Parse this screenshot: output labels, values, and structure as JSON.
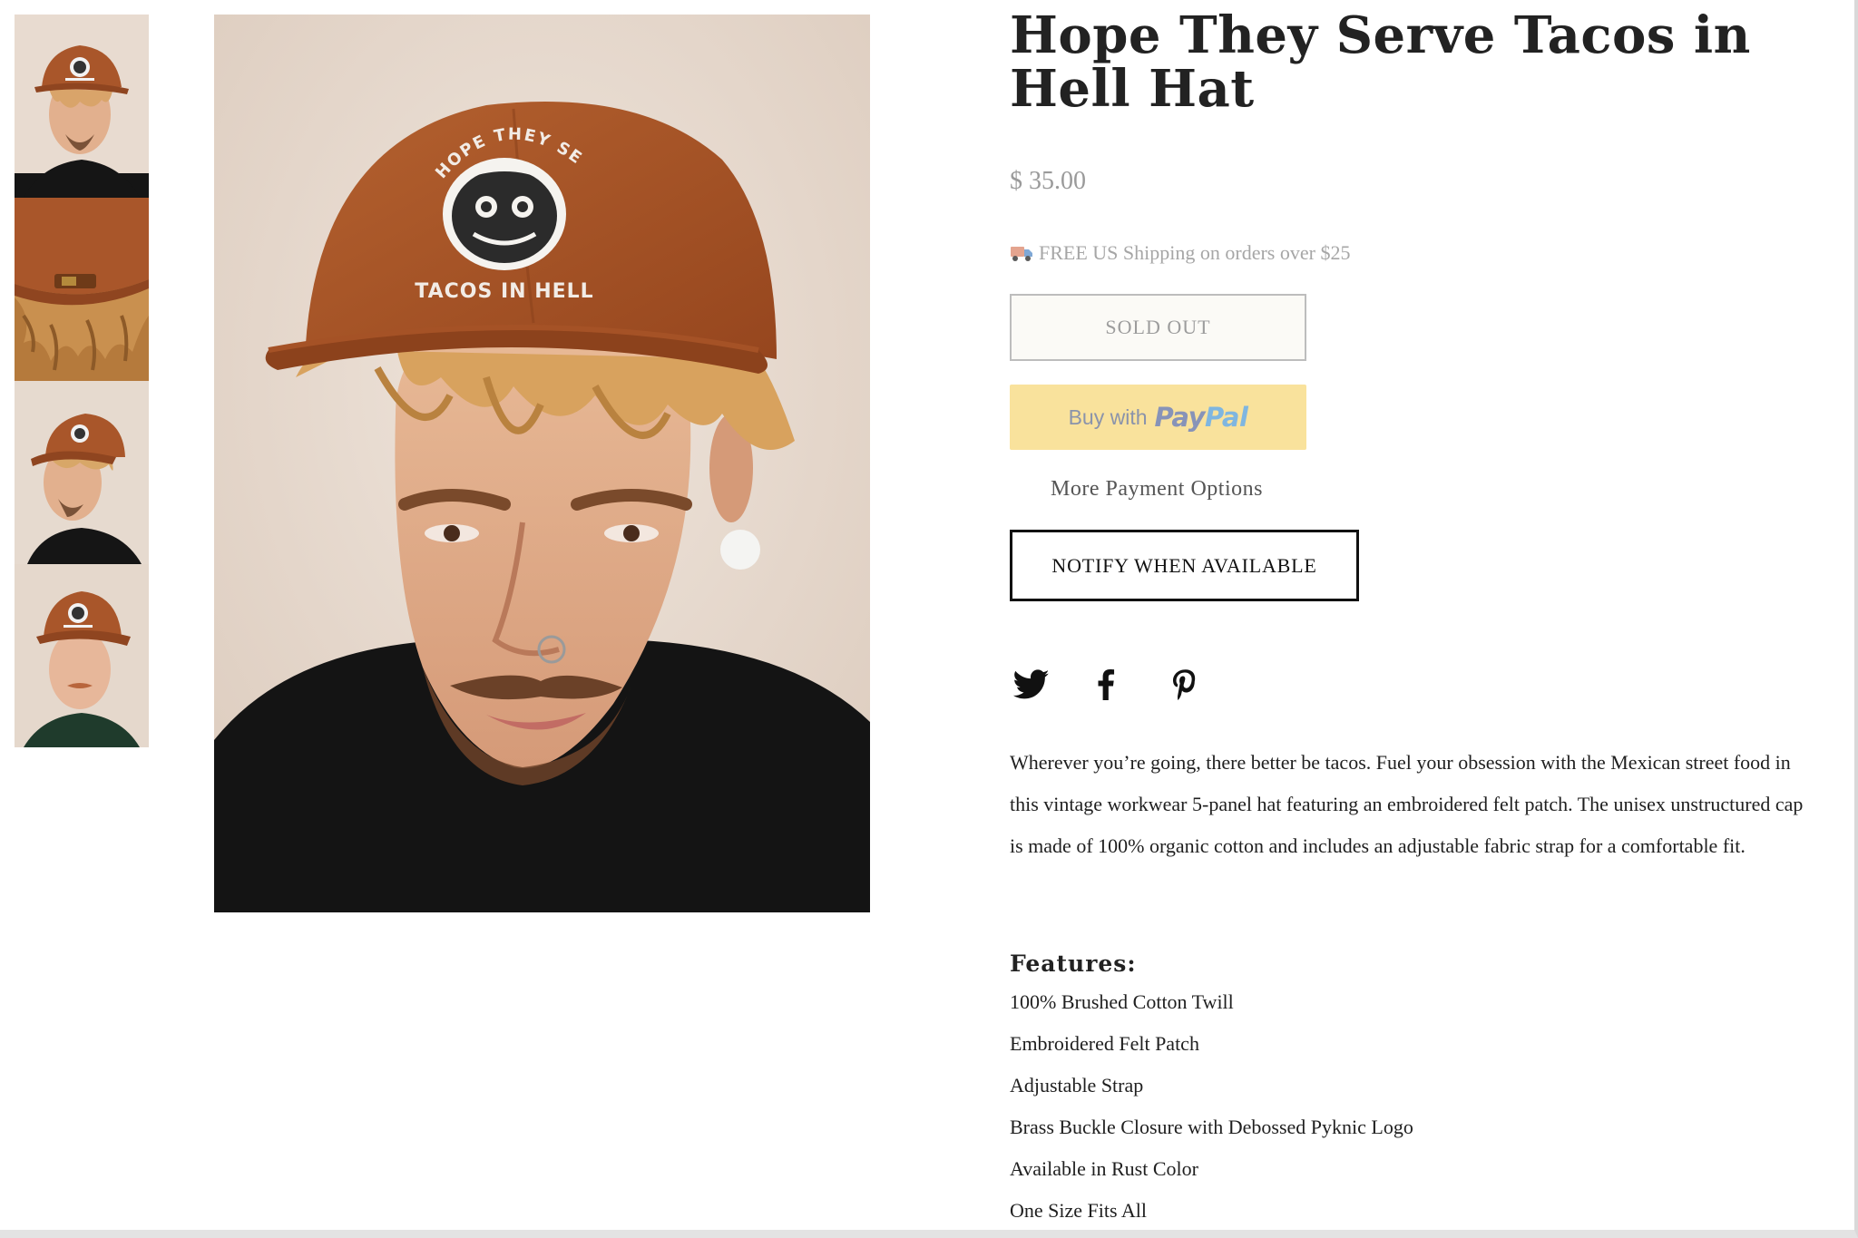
{
  "product": {
    "title": "Hope They Serve Tacos in Hell Hat",
    "price": "$ 35.00",
    "shipping_text": "FREE US Shipping on orders over $25",
    "shipping_icon": "truck-icon",
    "sold_out_label": "SOLD OUT",
    "paypal": {
      "buy_with": "Buy with",
      "pay": "Pay",
      "pal": "Pal"
    },
    "more_payment_options": "More Payment Options",
    "notify_label": "NOTIFY WHEN AVAILABLE",
    "description": "Wherever you’re going, there better be tacos. Fuel your obsession with the Mexican street food in this vintage workwear 5-panel hat featuring an embroidered felt patch. The unisex unstructured cap is made of 100% organic cotton and includes an adjustable fabric strap for a comfortable fit.",
    "features_title": "Features:",
    "features": [
      "100% Brushed Cotton Twill",
      "Embroidered Felt Patch",
      "Adjustable Strap",
      "Brass Buckle Closure with Debossed Pyknic Logo",
      "Available in Rust Color",
      "One Size Fits All"
    ]
  },
  "hat_patch": {
    "arc_text": "HOPE THEY SERVE",
    "bottom_text": "TACOS IN HELL"
  },
  "social_icons": [
    "twitter-icon",
    "facebook-icon",
    "pinterest-icon"
  ],
  "colors": {
    "hat_rust": "#a9562a",
    "background_beige": "#e9dcd2",
    "paypal_yellow": "#f9e29c",
    "price_gray": "#9a9a9a"
  }
}
